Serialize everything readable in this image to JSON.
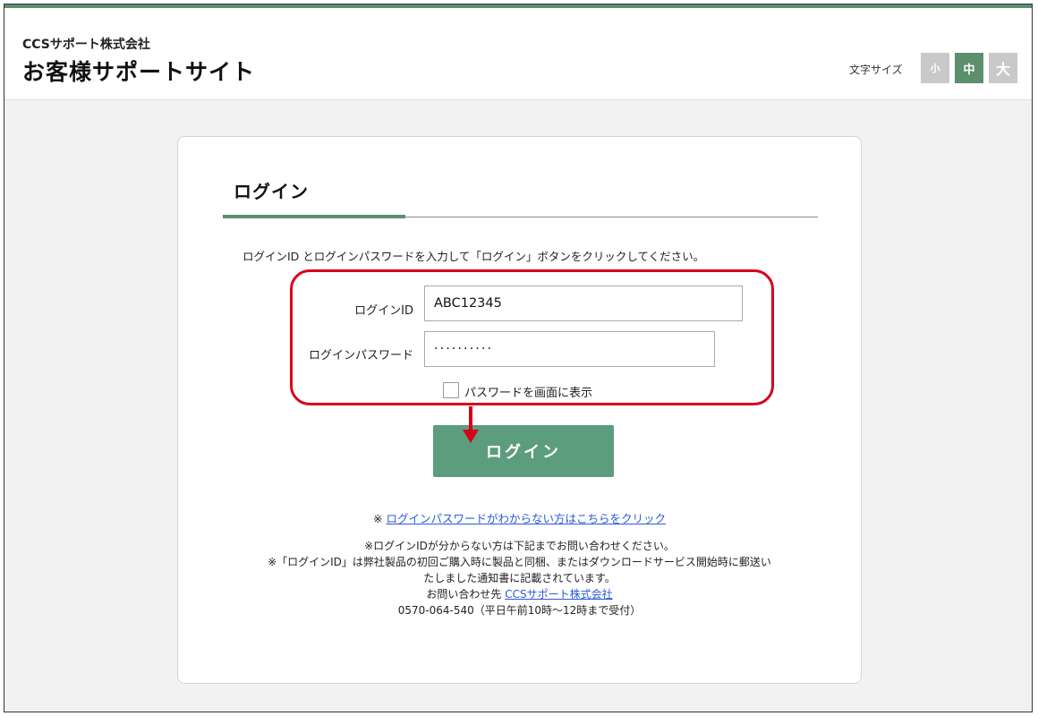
{
  "header": {
    "company": "CCSサポート株式会社",
    "site_title": "お客様サポートサイト",
    "font_size_label": "文字サイズ",
    "font_sizes": {
      "small": "小",
      "medium": "中",
      "large": "大"
    },
    "selected_font_size": "中"
  },
  "login": {
    "title": "ログイン",
    "instruction": "ログインID とログインパスワードを入力して「ログイン」ボタンをクリックしてください。",
    "id_label": "ログインID",
    "id_value": "ABC12345",
    "password_label": "ログインパスワード",
    "password_masked": "··········",
    "show_password_label": "パスワードを画面に表示",
    "show_password_checked": false,
    "submit_label": "ログイン"
  },
  "help": {
    "forgot_prefix": "※",
    "forgot_link": "ログインパスワードがわからない方はこちらをクリック",
    "note1": "※ログインIDが分からない方は下記までお問い合わせください。",
    "note2": "※「ログインID」は弊社製品の初回ご購入時に製品と同梱、またはダウンロードサービス開始時に郵送い",
    "note3": "たしました通知書に記載されています。",
    "contact_prefix": "お問い合わせ先",
    "contact_link": "CCSサポート株式会社",
    "phone": "0570-064-540（平日午前10時～12時まで受付）"
  },
  "colors": {
    "accent": "#5b8f6e",
    "button": "#5b9d7c",
    "highlight": "#d7001a",
    "link": "#2a5bd7"
  }
}
